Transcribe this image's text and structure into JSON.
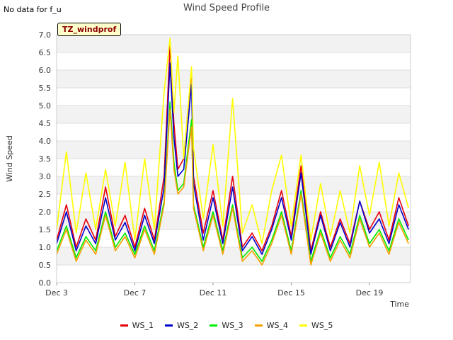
{
  "header": {
    "no_data_text": "No data for f_u"
  },
  "chart_data": {
    "type": "line",
    "title": "Wind Speed Profile",
    "xlabel": "Time",
    "ylabel": "Wind Speed",
    "annotation": "TZ_windprof",
    "ylim": [
      0.0,
      7.0
    ],
    "xlim_days": [
      "Dec 3",
      "Dec 21.1"
    ],
    "y_ticks": [
      "0.0",
      "0.5",
      "1.0",
      "1.5",
      "2.0",
      "2.5",
      "3.0",
      "3.5",
      "4.0",
      "4.5",
      "5.0",
      "5.5",
      "6.0",
      "6.5",
      "7.0"
    ],
    "x_ticks": [
      {
        "label": "Dec 3",
        "day": 3
      },
      {
        "label": "Dec 7",
        "day": 7
      },
      {
        "label": "Dec 11",
        "day": 11
      },
      {
        "label": "Dec 15",
        "day": 15
      },
      {
        "label": "Dec 19",
        "day": 19
      }
    ],
    "grid": "horizontal bands",
    "legend_position": "bottom",
    "x_days": [
      3.0,
      3.5,
      4.0,
      4.5,
      5.0,
      5.5,
      6.0,
      6.5,
      7.0,
      7.5,
      8.0,
      8.5,
      8.8,
      9.0,
      9.2,
      9.5,
      9.9,
      10.0,
      10.5,
      11.0,
      11.5,
      12.0,
      12.5,
      13.0,
      13.5,
      14.0,
      14.5,
      15.0,
      15.5,
      16.0,
      16.5,
      17.0,
      17.5,
      18.0,
      18.5,
      19.0,
      19.5,
      20.0,
      20.5,
      21.0
    ],
    "series": [
      {
        "name": "WS_1",
        "color": "#e8000b",
        "values": [
          1.2,
          2.2,
          1.0,
          1.8,
          1.2,
          2.7,
          1.3,
          1.9,
          1.0,
          2.1,
          1.2,
          3.0,
          6.7,
          4.5,
          3.2,
          3.5,
          6.0,
          3.0,
          1.4,
          2.6,
          1.2,
          3.0,
          1.0,
          1.4,
          0.9,
          1.6,
          2.6,
          1.3,
          3.3,
          0.9,
          2.0,
          1.0,
          1.8,
          1.1,
          2.3,
          1.5,
          2.0,
          1.2,
          2.4,
          1.6
        ]
      },
      {
        "name": "WS_2",
        "color": "#0000cc",
        "values": [
          1.1,
          2.0,
          0.9,
          1.6,
          1.1,
          2.4,
          1.2,
          1.7,
          0.9,
          1.9,
          1.1,
          2.7,
          6.2,
          4.1,
          3.0,
          3.2,
          5.6,
          2.8,
          1.2,
          2.4,
          1.1,
          2.7,
          0.9,
          1.3,
          0.8,
          1.5,
          2.4,
          1.2,
          3.1,
          0.8,
          1.9,
          0.9,
          1.7,
          1.0,
          2.3,
          1.4,
          1.8,
          1.1,
          2.2,
          1.5
        ]
      },
      {
        "name": "WS_3",
        "color": "#00ee00",
        "values": [
          0.9,
          1.6,
          0.7,
          1.3,
          0.9,
          2.0,
          1.0,
          1.4,
          0.8,
          1.6,
          0.9,
          2.3,
          5.1,
          3.4,
          2.6,
          2.8,
          4.6,
          2.2,
          1.0,
          2.0,
          0.9,
          2.2,
          0.7,
          1.0,
          0.6,
          1.2,
          2.0,
          0.9,
          2.6,
          0.6,
          1.5,
          0.7,
          1.3,
          0.8,
          1.9,
          1.1,
          1.5,
          0.9,
          1.8,
          1.2
        ]
      },
      {
        "name": "WS_4",
        "color": "#f5a000",
        "values": [
          0.8,
          1.5,
          0.6,
          1.2,
          0.8,
          1.9,
          0.9,
          1.3,
          0.7,
          1.5,
          0.8,
          2.2,
          4.9,
          3.2,
          2.5,
          2.7,
          4.4,
          2.1,
          0.9,
          1.9,
          0.8,
          2.1,
          0.6,
          0.9,
          0.5,
          1.1,
          1.9,
          0.8,
          2.5,
          0.5,
          1.4,
          0.6,
          1.2,
          0.7,
          1.8,
          1.0,
          1.4,
          0.8,
          1.7,
          1.1
        ]
      },
      {
        "name": "WS_5",
        "color": "#ffff00",
        "values": [
          1.5,
          3.7,
          1.4,
          3.1,
          1.5,
          3.2,
          1.6,
          3.4,
          1.2,
          3.5,
          1.5,
          5.4,
          6.9,
          4.8,
          6.4,
          3.5,
          6.1,
          3.8,
          1.8,
          3.9,
          1.6,
          5.2,
          1.4,
          2.2,
          1.1,
          2.6,
          3.6,
          1.6,
          3.6,
          1.2,
          2.8,
          1.3,
          2.6,
          1.4,
          3.3,
          1.9,
          3.4,
          1.6,
          3.1,
          2.1
        ]
      }
    ]
  }
}
